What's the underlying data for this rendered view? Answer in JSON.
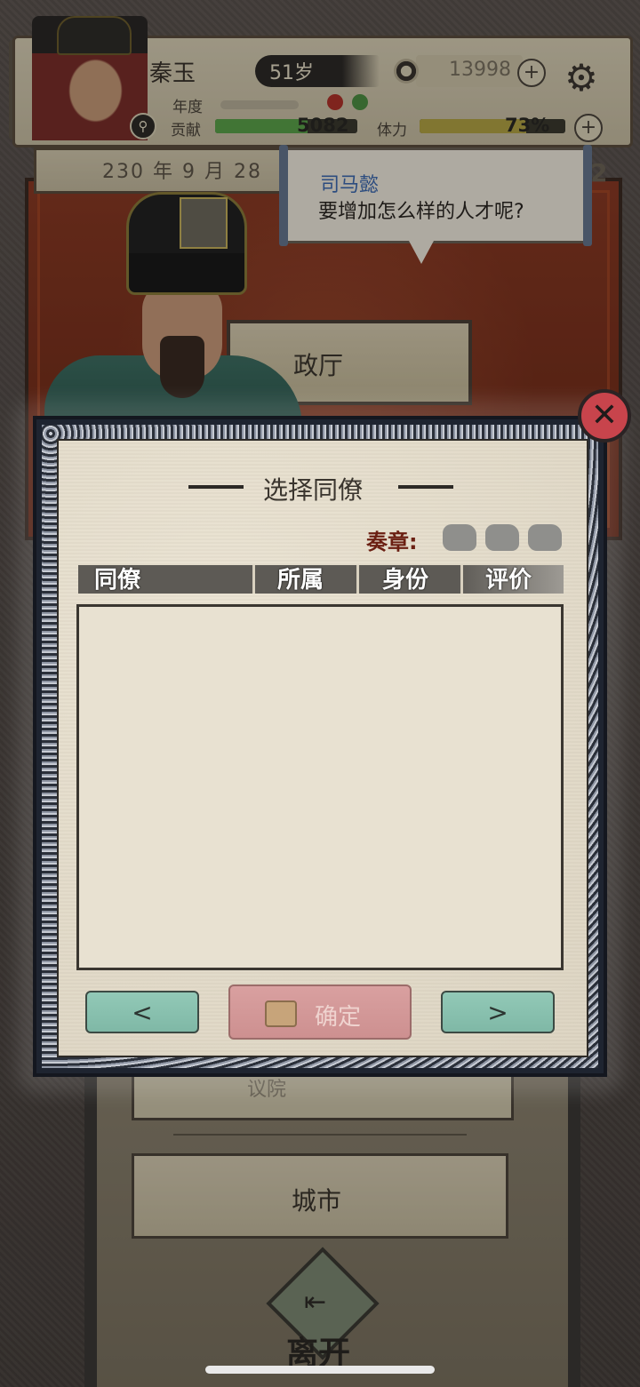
{
  "status": {
    "player_name": "秦玉",
    "age": "51岁",
    "money": "13998",
    "year_label": "年度",
    "contribution_label": "贡献",
    "contribution_value": "5082",
    "stamina_label": "体力",
    "stamina_value": "73%",
    "stamina_fraction": 0.73,
    "contribution_fraction": 0.65
  },
  "date": "230 年 9 月 28",
  "side_badge": "2",
  "dialogue": {
    "speaker": "司马懿",
    "text": "要增加怎么样的人才呢?"
  },
  "background": {
    "hall_label": "政厅",
    "behind_card_label": "议院",
    "city_label": "城市",
    "leave_label": "离开"
  },
  "modal": {
    "title": "选择同僚",
    "memorial_label": "奏章:",
    "memorial_count": 3,
    "columns": [
      "同僚",
      "所属",
      "身份",
      "评价"
    ],
    "rows": [],
    "prev_label": "<",
    "confirm_label": "确定",
    "next_label": ">"
  },
  "icons": {
    "close": "close-icon",
    "settings": "gear-icon",
    "search": "search-icon",
    "coin": "coin-icon",
    "confirm": "scroll-icon",
    "leave": "exit-icon"
  },
  "colors": {
    "dialogue_speaker": "#3d6ab0",
    "memorial_label": "#6b1f12",
    "confirm_button": "#d9a0a0",
    "nav_button": "#92c9b7",
    "close_button": "#c8444c",
    "contribution_bar": "#5aa24a",
    "stamina_bar": "#b3a444"
  }
}
